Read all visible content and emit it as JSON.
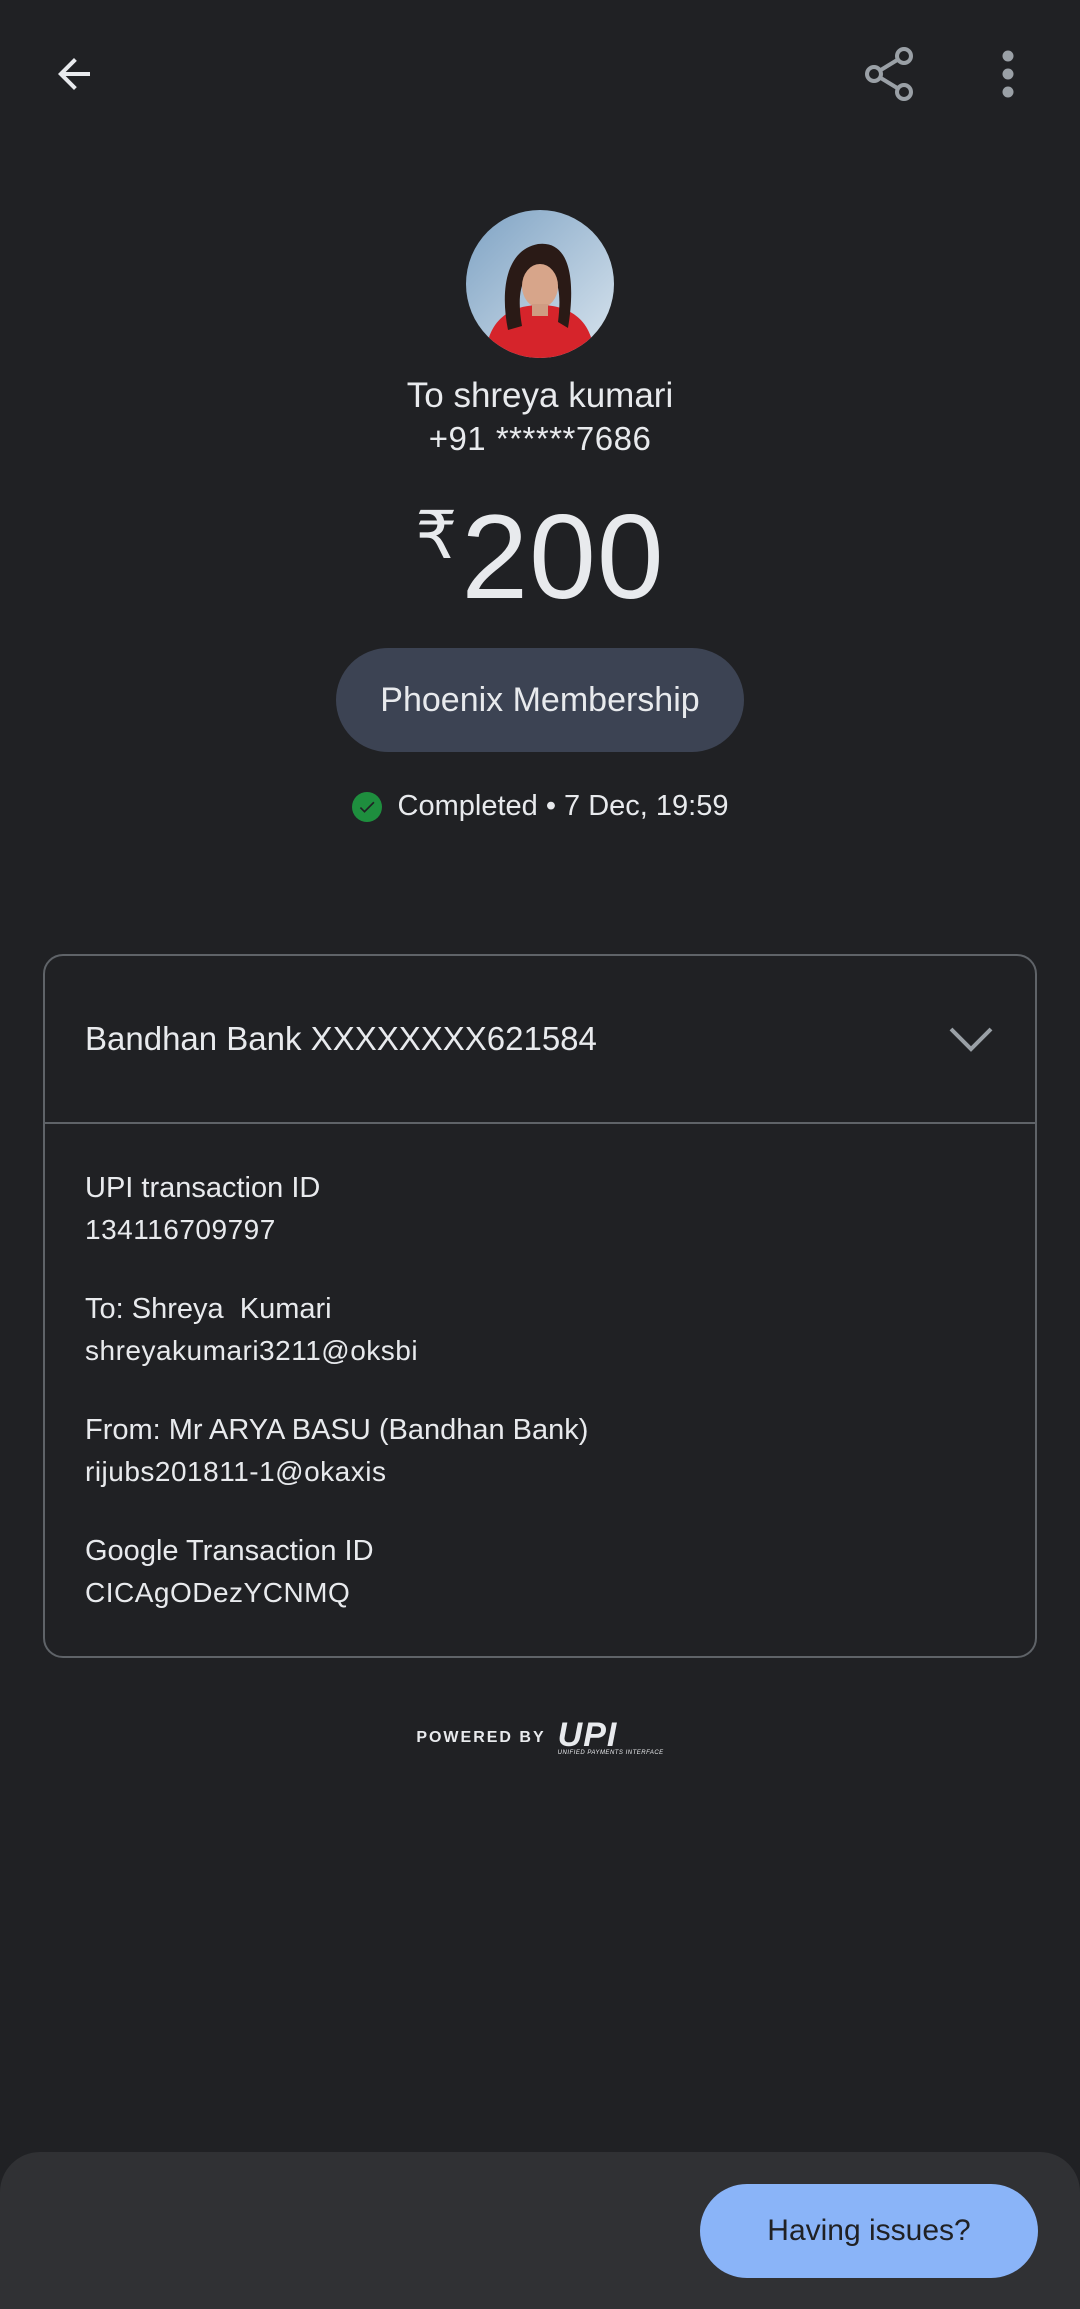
{
  "header": {
    "back_icon": "arrow-back-icon",
    "share_icon": "share-icon",
    "more_icon": "more-vert-icon"
  },
  "recipient": {
    "name_line": "To shreya kumari",
    "phone": "+91 ******7686"
  },
  "payment": {
    "currency_symbol": "₹",
    "amount": "200",
    "note": "Phoenix Membership"
  },
  "status": {
    "text": "Completed • 7 Dec, 19:59",
    "color": "#1e8e3e"
  },
  "details": {
    "bank_account": "Bandhan Bank XXXXXXXX621584",
    "rows": [
      {
        "label": "UPI transaction ID",
        "value": "134116709797"
      },
      {
        "label": "To: Shreya  Kumari",
        "value": "shreyakumari3211@oksbi"
      },
      {
        "label": "From: Mr ARYA BASU (Bandhan Bank)",
        "value": "rijubs201811-1@okaxis"
      },
      {
        "label": "Google Transaction ID",
        "value": "CICAgODezYCNMQ"
      }
    ]
  },
  "footer": {
    "powered_by": "POWERED BY",
    "upi_mark": "UPI",
    "upi_sub": "UNIFIED PAYMENTS INTERFACE"
  },
  "actions": {
    "having_issues": "Having issues?",
    "accent": "#8ab4f8"
  }
}
